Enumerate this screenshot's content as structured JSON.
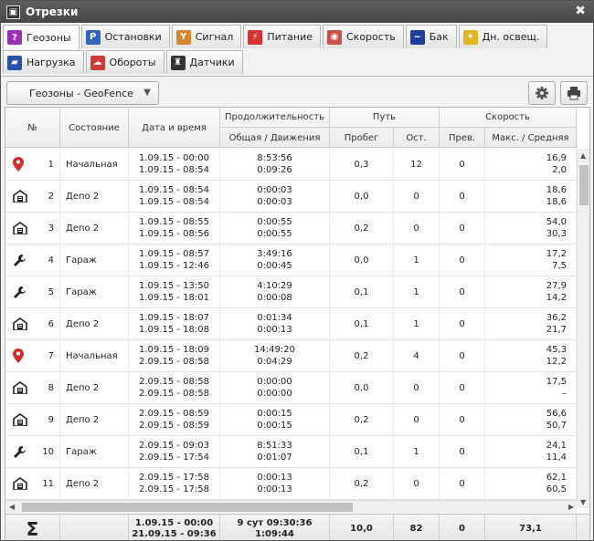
{
  "window": {
    "title": "Отрезки",
    "close_glyph": "✖"
  },
  "tabs_row1": [
    {
      "label": "Геозоны",
      "icon": "geofence-icon",
      "color": "#9b2fb5",
      "glyph": "?",
      "active": true
    },
    {
      "label": "Остановки",
      "icon": "parking-icon",
      "color": "#2e66c4",
      "glyph": "P",
      "active": false
    },
    {
      "label": "Сигнал",
      "icon": "signal-icon",
      "color": "#d9862a",
      "glyph": "Y",
      "active": false
    },
    {
      "label": "Питание",
      "icon": "power-icon",
      "color": "#d93030",
      "glyph": "⚡",
      "active": false
    },
    {
      "label": "Скорость",
      "icon": "speedometer-icon",
      "color": "#c9514a",
      "glyph": "◉",
      "active": false
    },
    {
      "label": "Бак",
      "icon": "fuel-tank-icon",
      "color": "#1f3f9e",
      "glyph": "~",
      "active": false
    },
    {
      "label": "Дн. освещ.",
      "icon": "daylight-icon",
      "color": "#e0b81e",
      "glyph": "✶",
      "active": false
    }
  ],
  "tabs_row2": [
    {
      "label": "Нагрузка",
      "icon": "load-icon",
      "color": "#2a4fa8",
      "glyph": "▰"
    },
    {
      "label": "Обороты",
      "icon": "rpm-icon",
      "color": "#d23a3a",
      "glyph": "☁"
    },
    {
      "label": "Датчики",
      "icon": "sensor-icon",
      "color": "#333333",
      "glyph": "♜"
    }
  ],
  "toolbar": {
    "dropdown_value": "Геозоны - GeoFence",
    "dropdown_arrow": "▼",
    "settings_icon": "gear-icon",
    "print_icon": "printer-icon"
  },
  "columns": {
    "num": "№",
    "state": "Состояние",
    "datetime": "Дата и время",
    "duration": "Продолжительность",
    "duration_sub": "Общая / Движения",
    "path": "Путь",
    "mileage": "Пробег",
    "remaining": "Ост.",
    "speed": "Скорость",
    "exceed": "Прев.",
    "max_avg": "Макс. / Средняя"
  },
  "rows": [
    {
      "icon": "pin",
      "num": "1",
      "state": "Начальная",
      "d1": "1.09.15 - 00:00",
      "d2": "1.09.15 - 08:54",
      "t1": "8:53:56",
      "t2": "0:09:26",
      "mileage": "0,3",
      "rest": "12",
      "exceed": "0",
      "max": "16,9",
      "avg": "2,0"
    },
    {
      "icon": "depot",
      "num": "2",
      "state": "Депо 2",
      "d1": "1.09.15 - 08:54",
      "d2": "1.09.15 - 08:54",
      "t1": "0:00:03",
      "t2": "0:00:03",
      "mileage": "0,0",
      "rest": "0",
      "exceed": "0",
      "max": "18,6",
      "avg": "18,6"
    },
    {
      "icon": "depot",
      "num": "3",
      "state": "Депо 2",
      "d1": "1.09.15 - 08:55",
      "d2": "1.09.15 - 08:56",
      "t1": "0:00:55",
      "t2": "0:00:55",
      "mileage": "0,2",
      "rest": "0",
      "exceed": "0",
      "max": "54,0",
      "avg": "30,3"
    },
    {
      "icon": "wrench",
      "num": "4",
      "state": "Гараж",
      "d1": "1.09.15 - 08:57",
      "d2": "1.09.15 - 12:46",
      "t1": "3:49:16",
      "t2": "0:00:45",
      "mileage": "0,0",
      "rest": "1",
      "exceed": "0",
      "max": "17,2",
      "avg": "7,5"
    },
    {
      "icon": "wrench",
      "num": "5",
      "state": "Гараж",
      "d1": "1.09.15 - 13:50",
      "d2": "1.09.15 - 18:01",
      "t1": "4:10:29",
      "t2": "0:00:08",
      "mileage": "0,1",
      "rest": "1",
      "exceed": "0",
      "max": "27,9",
      "avg": "14,2"
    },
    {
      "icon": "depot",
      "num": "6",
      "state": "Депо 2",
      "d1": "1.09.15 - 18:07",
      "d2": "1.09.15 - 18:08",
      "t1": "0:01:34",
      "t2": "0:00:13",
      "mileage": "0,1",
      "rest": "1",
      "exceed": "0",
      "max": "36,2",
      "avg": "21,7"
    },
    {
      "icon": "pin",
      "num": "7",
      "state": "Начальная",
      "d1": "1.09.15 - 18:09",
      "d2": "2.09.15 - 08:58",
      "t1": "14:49:20",
      "t2": "0:04:29",
      "mileage": "0,2",
      "rest": "4",
      "exceed": "0",
      "max": "45,3",
      "avg": "12,2"
    },
    {
      "icon": "depot",
      "num": "8",
      "state": "Депо 2",
      "d1": "2.09.15 - 08:58",
      "d2": "2.09.15 - 08:58",
      "t1": "0:00:00",
      "t2": "0:00:00",
      "mileage": "0,0",
      "rest": "0",
      "exceed": "0",
      "max": "17,5",
      "avg": "–"
    },
    {
      "icon": "depot",
      "num": "9",
      "state": "Депо 2",
      "d1": "2.09.15 - 08:59",
      "d2": "2.09.15 - 08:59",
      "t1": "0:00:15",
      "t2": "0:00:15",
      "mileage": "0,2",
      "rest": "0",
      "exceed": "0",
      "max": "56,6",
      "avg": "50,7"
    },
    {
      "icon": "wrench",
      "num": "10",
      "state": "Гараж",
      "d1": "2.09.15 - 09:03",
      "d2": "2.09.15 - 17:54",
      "t1": "8:51:33",
      "t2": "0:01:07",
      "mileage": "0,1",
      "rest": "1",
      "exceed": "0",
      "max": "24,1",
      "avg": "11,4"
    },
    {
      "icon": "depot",
      "num": "11",
      "state": "Депо 2",
      "d1": "2.09.15 - 17:58",
      "d2": "2.09.15 - 17:58",
      "t1": "0:00:13",
      "t2": "0:00:13",
      "mileage": "0,2",
      "rest": "0",
      "exceed": "0",
      "max": "62,1",
      "avg": "60,5"
    }
  ],
  "totals": {
    "sigma": "Σ",
    "d1": "1.09.15 - 00:00",
    "d2": "21.09.15 - 09:36",
    "t1": "9 сут 09:30:36",
    "t2": "1:09:44",
    "mileage": "10,0",
    "rest": "82",
    "exceed": "0",
    "max": "73,1"
  },
  "colors": {
    "pin": "#d32c2c",
    "accent": "#9b2fb5"
  }
}
